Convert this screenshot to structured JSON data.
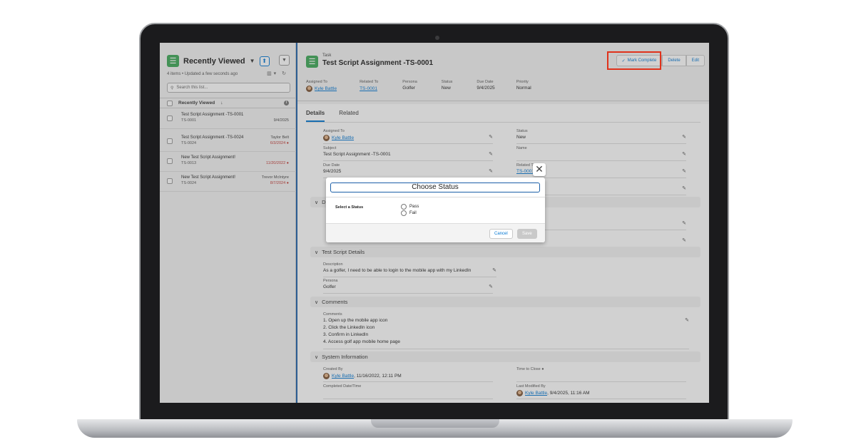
{
  "list": {
    "title": "Recently Viewed",
    "meta": "4 items • Updated a few seconds ago",
    "search_placeholder": "Search this list...",
    "column": "Recently Viewed",
    "sort_icon": "↓",
    "rows": [
      {
        "title": "Test Script Assignment -TS-0001",
        "id": "TS-0001",
        "owner": "",
        "date": "9/4/2025",
        "overdue": false
      },
      {
        "title": "Test Script Assignment -TS-0024",
        "id": "TS-0024",
        "owner": "Taylor Belt",
        "date": "6/3/2024",
        "overdue": true
      },
      {
        "title": "New Test Script Assignment!",
        "id": "TS-0013",
        "owner": "",
        "date": "11/20/2022",
        "overdue": true
      },
      {
        "title": "New Test Script Assignment!",
        "id": "TS-0024",
        "owner": "Trevor McIntyre",
        "date": "8/7/2024",
        "overdue": true
      }
    ]
  },
  "record": {
    "object": "Task",
    "title": "Test Script Assignment -TS-0001",
    "buttons": {
      "mark_complete": "Mark Complete",
      "delete": "Delete",
      "edit": "Edit"
    },
    "highlights": [
      {
        "label": "Assigned To",
        "value": "Kyle Battle"
      },
      {
        "label": "Related To",
        "value": "TS-0001"
      },
      {
        "label": "Persona",
        "value": "Golfer"
      },
      {
        "label": "Status",
        "value": "New"
      },
      {
        "label": "Due Date",
        "value": "9/4/2025"
      },
      {
        "label": "Priority",
        "value": "Normal"
      }
    ],
    "tabs": [
      "Details",
      "Related"
    ],
    "details": {
      "assigned_to_label": "Assigned To",
      "assigned_to": "Kyle Battle",
      "status_label": "Status",
      "status": "New",
      "subject_label": "Subject",
      "subject": "Test Script Assignment -TS-0001",
      "name_label": "Name",
      "due_label": "Due Date",
      "due": "9/4/2025",
      "related_label": "Related To",
      "related": "TS-0001"
    },
    "sections": {
      "test_script": "Test Script Details",
      "comments": "Comments",
      "system": "System Information",
      "d_partial": "D"
    },
    "test_script": {
      "desc_label": "Description",
      "desc": "As a golfer, I need to be able to login to the mobile app with my LinkedIn",
      "persona_label": "Persona",
      "persona": "Golfer"
    },
    "comments": {
      "label": "Comments",
      "lines": [
        "1. Open up the mobile app icon",
        "2. Click the LinkedIn icon",
        "3. Confirm in LinkedIn",
        "4. Access golf app mobile home page"
      ]
    },
    "system": {
      "created_label": "Created By",
      "created_user": "Kyle Battle",
      "created_when": ", 11/16/2022, 12:11 PM",
      "close_label": "Time to Close",
      "completed_label": "Completed Date/Time",
      "modified_label": "Last Modified By",
      "modified_user": "Kyle Battle",
      "modified_when": ", 9/4/2025, 11:16 AM"
    }
  },
  "modal": {
    "title": "Choose Status",
    "select_label": "Select a Status",
    "options": [
      "Pass",
      "Fail"
    ],
    "cancel": "Cancel",
    "save": "Save",
    "close": "✕"
  },
  "colors": {
    "accent": "#0176d3",
    "highlight_border": "#e0321b",
    "app_icon": "#3ba755"
  }
}
